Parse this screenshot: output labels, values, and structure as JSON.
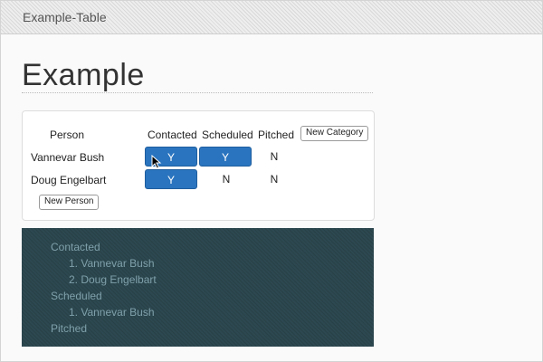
{
  "window": {
    "title": "Example-Table"
  },
  "page": {
    "heading": "Example"
  },
  "table": {
    "headers": {
      "person": "Person",
      "contacted": "Contacted",
      "scheduled": "Scheduled",
      "pitched": "Pitched"
    },
    "new_category_label": "New Category",
    "new_person_label": "New Person",
    "rows": [
      {
        "name": "Vannevar Bush",
        "contacted": "Y",
        "scheduled": "Y",
        "pitched": "N"
      },
      {
        "name": "Doug Engelbart",
        "contacted": "Y",
        "scheduled": "N",
        "pitched": "N"
      }
    ]
  },
  "summary": {
    "categories": [
      {
        "label": "Contacted",
        "items": [
          "1. Vannevar Bush",
          "2. Doug Engelbart"
        ]
      },
      {
        "label": "Scheduled",
        "items": [
          "1. Vannevar Bush"
        ]
      },
      {
        "label": "Pitched",
        "items": []
      }
    ]
  },
  "colors": {
    "yes_button": "#2a74bf",
    "summary_bg": "#2d4850",
    "summary_text": "#7fa0aa"
  },
  "icons": {
    "cursor": "mouse-pointer-icon"
  }
}
